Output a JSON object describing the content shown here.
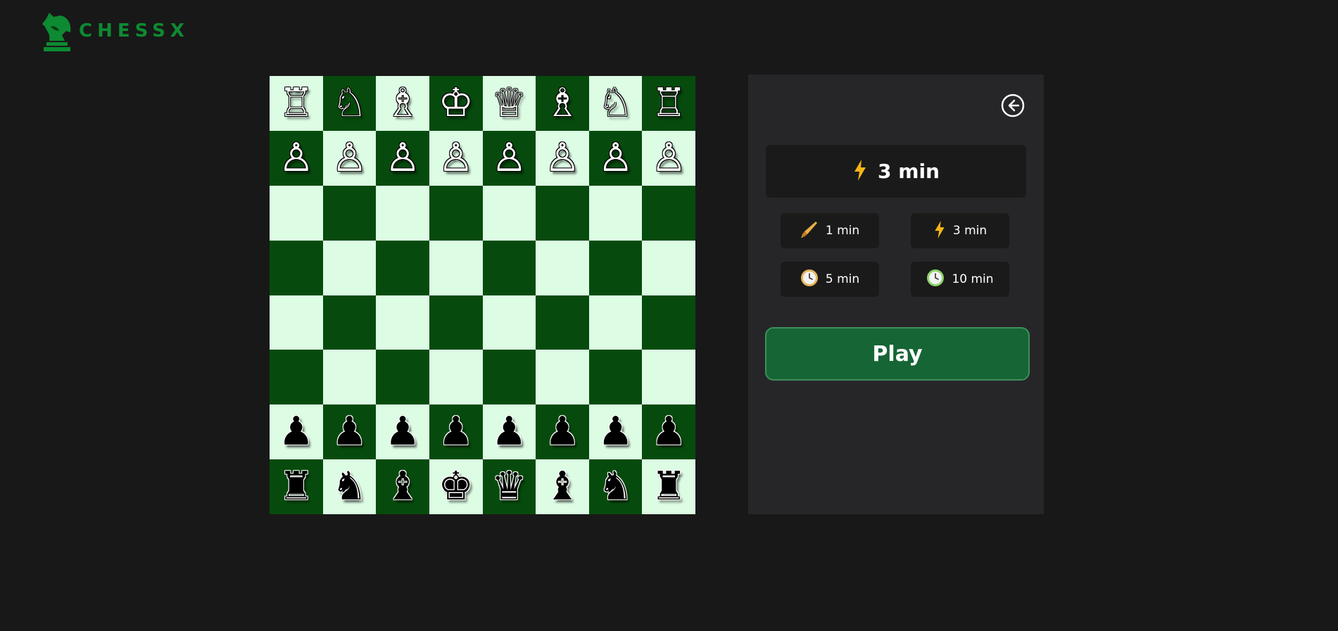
{
  "app": {
    "logo_text": "CHESSX",
    "brand_color": "#0e8a32"
  },
  "board": {
    "light_color": "#dcfce4",
    "dark_color": "#064b0d",
    "ranks": [
      [
        "♖",
        "♘",
        "♗",
        "♔",
        "♕",
        "♗",
        "♘",
        "♖"
      ],
      [
        "♙",
        "♙",
        "♙",
        "♙",
        "♙",
        "♙",
        "♙",
        "♙"
      ],
      [
        "",
        "",
        "",
        "",
        "",
        "",
        "",
        ""
      ],
      [
        "",
        "",
        "",
        "",
        "",
        "",
        "",
        ""
      ],
      [
        "",
        "",
        "",
        "",
        "",
        "",
        "",
        ""
      ],
      [
        "",
        "",
        "",
        "",
        "",
        "",
        "",
        ""
      ],
      [
        "♟",
        "♟",
        "♟",
        "♟",
        "♟",
        "♟",
        "♟",
        "♟"
      ],
      [
        "♜",
        "♞",
        "♝",
        "♚",
        "♛",
        "♝",
        "♞",
        "♜"
      ]
    ],
    "piece_colors": [
      [
        "w",
        "w",
        "w",
        "w",
        "w",
        "w",
        "w",
        "w"
      ],
      [
        "w",
        "w",
        "w",
        "w",
        "w",
        "w",
        "w",
        "w"
      ],
      [
        "",
        "",
        "",
        "",
        "",
        "",
        "",
        ""
      ],
      [
        "",
        "",
        "",
        "",
        "",
        "",
        "",
        ""
      ],
      [
        "",
        "",
        "",
        "",
        "",
        "",
        "",
        ""
      ],
      [
        "",
        "",
        "",
        "",
        "",
        "",
        "",
        ""
      ],
      [
        "b",
        "b",
        "b",
        "b",
        "b",
        "b",
        "b",
        "b"
      ],
      [
        "b",
        "b",
        "b",
        "b",
        "b",
        "b",
        "b",
        "b"
      ]
    ]
  },
  "panel": {
    "back_icon": "arrow-left-circle-icon",
    "selected": {
      "icon": "lightning-icon",
      "label": "3 min"
    },
    "options": [
      {
        "icon": "bullet-icon",
        "label": "1 min"
      },
      {
        "icon": "lightning-icon",
        "label": "3 min"
      },
      {
        "icon": "clock-icon",
        "label": "5 min"
      },
      {
        "icon": "green-clock-icon",
        "label": "10 min"
      }
    ],
    "play_label": "Play"
  }
}
